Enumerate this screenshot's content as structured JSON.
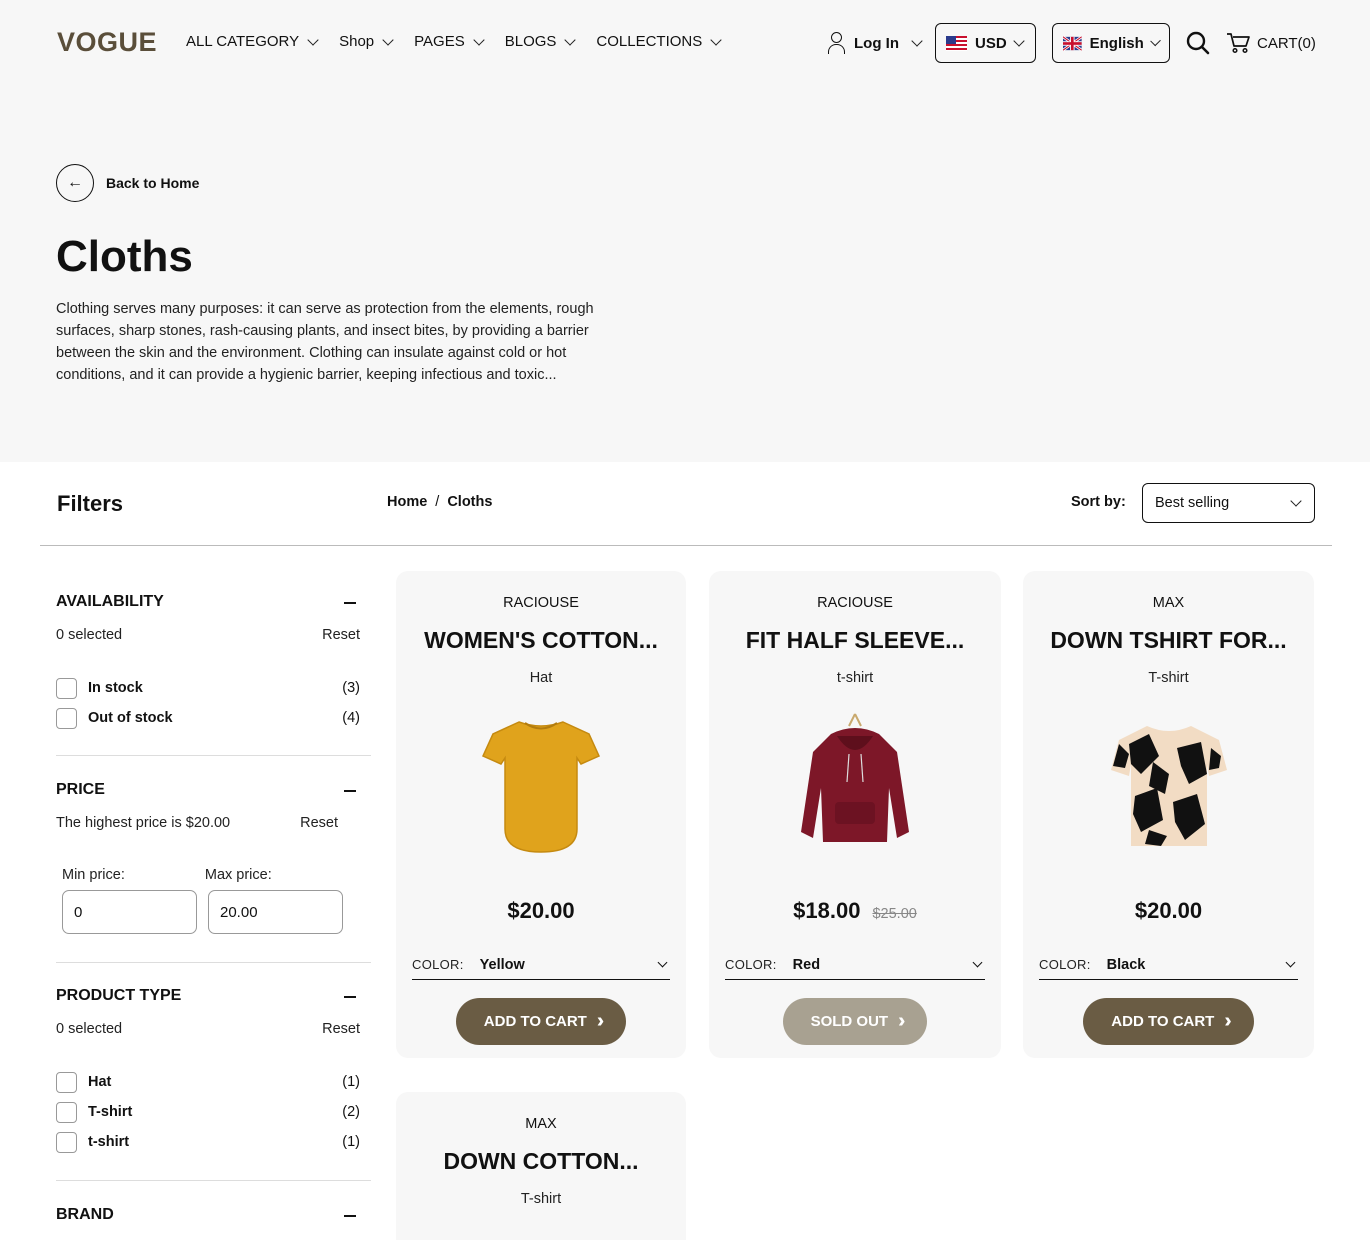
{
  "header": {
    "logo": "VOGUE",
    "nav": [
      {
        "label": "ALL CATEGORY"
      },
      {
        "label": "Shop"
      },
      {
        "label": "PAGES"
      },
      {
        "label": "BLOGS"
      },
      {
        "label": "COLLECTIONS"
      }
    ],
    "login_label": "Log In",
    "currency": "USD",
    "language": "English",
    "cart_label": "CART(0)"
  },
  "hero": {
    "back_label": "Back to Home",
    "title": "Cloths",
    "description": "Clothing serves many purposes: it can serve as protection from the elements, rough surfaces, sharp stones, rash-causing plants, and insect bites, by providing a barrier between the skin and the environment. Clothing can insulate against cold or hot conditions, and it can provide a hygienic barrier, keeping infectious and toxic..."
  },
  "toolbar": {
    "filters_title": "Filters",
    "breadcrumb": [
      "Home",
      "/",
      "Cloths"
    ],
    "sort_label": "Sort by:",
    "sort_value": "Best selling"
  },
  "filters": {
    "availability": {
      "title": "AVAILABILITY",
      "selected": "0 selected",
      "reset": "Reset",
      "options": [
        {
          "label": "In stock",
          "count": "(3)"
        },
        {
          "label": "Out of stock",
          "count": "(4)"
        }
      ]
    },
    "price": {
      "title": "PRICE",
      "highest": "The highest price is $20.00",
      "reset": "Reset",
      "min_label": "Min price:",
      "max_label": "Max price:",
      "min_value": "0",
      "max_value": "20.00"
    },
    "product_type": {
      "title": "PRODUCT TYPE",
      "selected": "0 selected",
      "reset": "Reset",
      "options": [
        {
          "label": "Hat",
          "count": "(1)"
        },
        {
          "label": "T-shirt",
          "count": "(2)"
        },
        {
          "label": "t-shirt",
          "count": "(1)"
        }
      ]
    },
    "brand": {
      "title": "BRAND"
    }
  },
  "products": [
    {
      "brand": "RACIOUSE",
      "name": "WOMEN'S COTTON...",
      "type": "Hat",
      "price": "$20.00",
      "compare_price": "",
      "color_label": "COLOR:",
      "color": "Yellow",
      "button": "ADD TO CART",
      "button_color": "#6a5c44"
    },
    {
      "brand": "RACIOUSE",
      "name": "FIT HALF SLEEVE...",
      "type": "t-shirt",
      "price": "$18.00",
      "compare_price": "$25.00",
      "color_label": "COLOR:",
      "color": "Red",
      "button": "SOLD OUT",
      "button_color": "#a8a191"
    },
    {
      "brand": "MAX",
      "name": "DOWN TSHIRT FOR...",
      "type": "T-shirt",
      "price": "$20.00",
      "compare_price": "",
      "color_label": "COLOR:",
      "color": "Black",
      "button": "ADD TO CART",
      "button_color": "#6a5c44"
    },
    {
      "brand": "MAX",
      "name": "DOWN COTTON...",
      "type": "T-shirt"
    }
  ]
}
